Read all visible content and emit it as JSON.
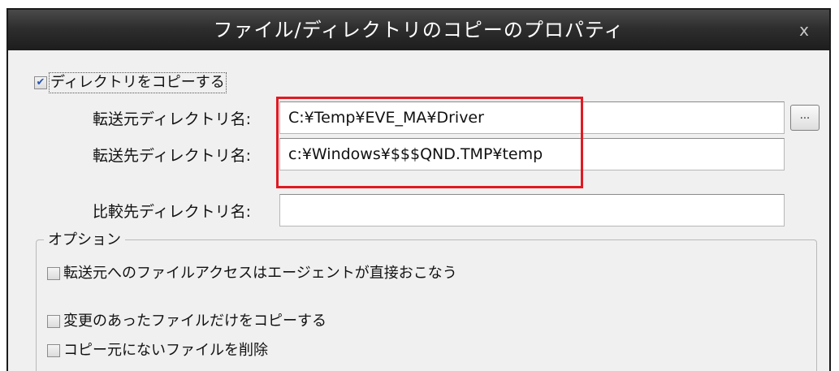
{
  "dialog": {
    "title": "ファイル/ディレクトリのコピーのプロパティ",
    "close_label": "x"
  },
  "copy_directory": {
    "label": "ディレクトリをコピーする",
    "checked": true
  },
  "fields": {
    "source": {
      "label": "転送元ディレクトリ名:",
      "value": "C:¥Temp¥EVE_MA¥Driver"
    },
    "destination": {
      "label": "転送先ディレクトリ名:",
      "value": "c:¥Windows¥$$$QND.TMP¥temp"
    },
    "compare": {
      "label": "比較先ディレクトリ名:",
      "value": ""
    },
    "browse_label": "..."
  },
  "options": {
    "title": "オプション",
    "items": [
      {
        "label": "転送元へのファイルアクセスはエージェントが直接おこなう",
        "checked": false
      },
      {
        "label": "変更のあったファイルだけをコピーする",
        "checked": false
      },
      {
        "label": "コピー元にないファイルを削除",
        "checked": false
      }
    ]
  },
  "colors": {
    "highlight": "#e01a22",
    "titlebar": "#2e2e2e",
    "dialog_bg": "#f0f0f0",
    "check_mark": "#2456b4"
  }
}
